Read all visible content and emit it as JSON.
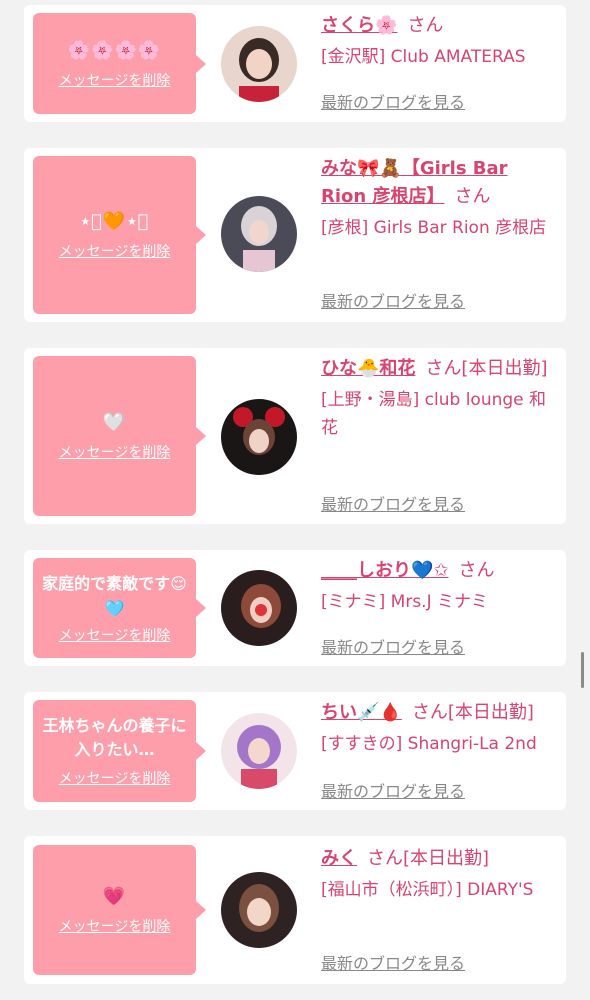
{
  "delete_label": "メッセージを削除",
  "blog_label": "最新のブログを見る",
  "honorific": "さん",
  "colors": {
    "accent": "#d8446f",
    "bubble": "#fe9eab",
    "link_gray": "#888888"
  },
  "entries": [
    {
      "message": "🌸🌸🌸🌸",
      "name": "さくら🌸",
      "suffix": "",
      "shop": "[金沢駅] Club AMATERAS"
    },
    {
      "message": "⋆͛🧡⋆͛",
      "name": "みな🎀🧸【Girls Bar Rion 彦根店】",
      "suffix": "",
      "shop": "[彦根] Girls Bar Rion 彦根店"
    },
    {
      "message": "🤍",
      "name": "ひな🐣和花",
      "suffix": "[本日出勤]",
      "shop": "[上野・湯島] club lounge 和花"
    },
    {
      "message": "家庭的で素敵です😌🩵",
      "name": "____しおり💙✩",
      "suffix": "",
      "shop": "[ミナミ] Mrs.J ミナミ"
    },
    {
      "message": "王林ちゃんの養子に入りたい…",
      "name": "ちい💉🩸",
      "suffix": "[本日出勤]",
      "shop": "[すすきの] Shangri-La 2nd"
    },
    {
      "message": "💗",
      "name": "みく",
      "suffix": "[本日出勤]",
      "shop": "[福山市（松浜町）] DIARY'S"
    }
  ]
}
